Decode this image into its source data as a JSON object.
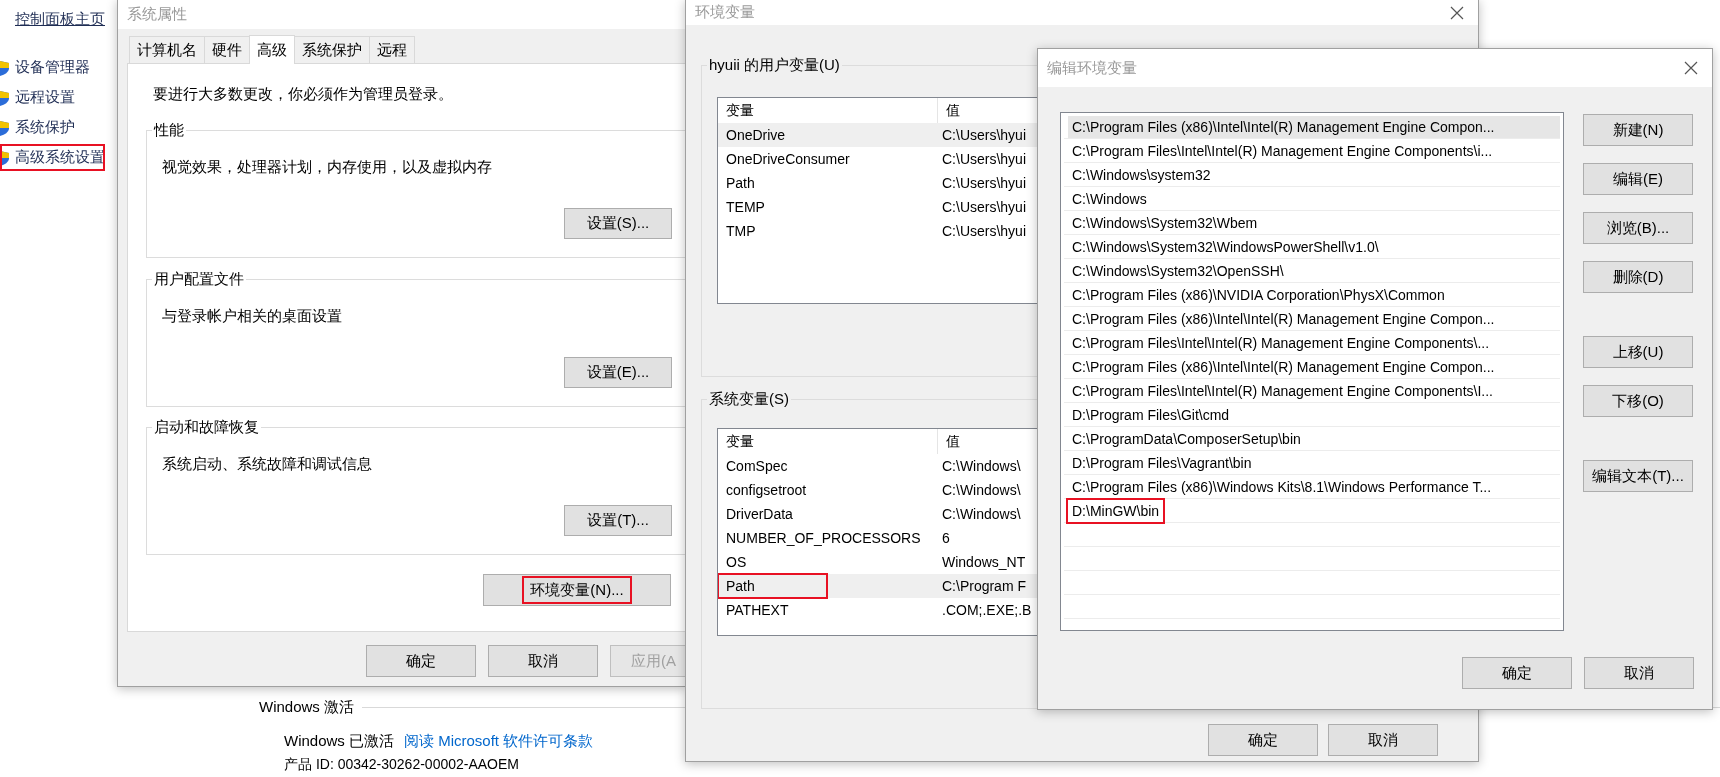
{
  "control_panel": {
    "home_link": "控制面板主页",
    "sidebar": {
      "items": [
        {
          "label": "设备管理器",
          "highlighted": false
        },
        {
          "label": "远程设置",
          "highlighted": false
        },
        {
          "label": "系统保护",
          "highlighted": false
        },
        {
          "label": "高级系统设置",
          "highlighted": true
        }
      ]
    },
    "activation": {
      "heading": "Windows 激活",
      "status": "Windows 已激活",
      "license_link": "阅读 Microsoft 软件许可条款",
      "product_id": "产品 ID: 00342-30262-00002-AAOEM"
    }
  },
  "system_properties": {
    "title": "系统属性",
    "tabs": [
      {
        "label": "计算机名",
        "selected": false
      },
      {
        "label": "硬件",
        "selected": false
      },
      {
        "label": "高级",
        "selected": true
      },
      {
        "label": "系统保护",
        "selected": false
      },
      {
        "label": "远程",
        "selected": false
      }
    ],
    "notice": "要进行大多数更改，你必须作为管理员登录。",
    "groups": [
      {
        "title": "性能",
        "description": "视觉效果，处理器计划，内存使用，以及虚拟内存",
        "button": "设置(S)..."
      },
      {
        "title": "用户配置文件",
        "description": "与登录帐户相关的桌面设置",
        "button": "设置(E)..."
      },
      {
        "title": "启动和故障恢复",
        "description": "系统启动、系统故障和调试信息",
        "button": "设置(T)..."
      }
    ],
    "env_button": {
      "label": "环境变量(N)...",
      "highlighted": true
    },
    "buttons": [
      {
        "label": "确定",
        "disabled": false
      },
      {
        "label": "取消",
        "disabled": false
      },
      {
        "label": "应用(A",
        "disabled": true
      }
    ]
  },
  "environment_variables": {
    "title": "环境变量",
    "user_vars": {
      "title": "hyuii 的用户变量(U)",
      "columns": [
        "变量",
        "值"
      ],
      "rows": [
        {
          "name": "OneDrive",
          "value": "C:\\Users\\hyui",
          "selected": true,
          "highlighted": false
        },
        {
          "name": "OneDriveConsumer",
          "value": "C:\\Users\\hyui",
          "selected": false,
          "highlighted": false
        },
        {
          "name": "Path",
          "value": "C:\\Users\\hyui",
          "selected": false,
          "highlighted": false
        },
        {
          "name": "TEMP",
          "value": "C:\\Users\\hyui",
          "selected": false,
          "highlighted": false
        },
        {
          "name": "TMP",
          "value": "C:\\Users\\hyui",
          "selected": false,
          "highlighted": false
        }
      ]
    },
    "system_vars": {
      "title": "系统变量(S)",
      "columns": [
        "变量",
        "值"
      ],
      "rows": [
        {
          "name": "ComSpec",
          "value": "C:\\Windows\\",
          "selected": false,
          "highlighted": false
        },
        {
          "name": "configsetroot",
          "value": "C:\\Windows\\",
          "selected": false,
          "highlighted": false
        },
        {
          "name": "DriverData",
          "value": "C:\\Windows\\",
          "selected": false,
          "highlighted": false
        },
        {
          "name": "NUMBER_OF_PROCESSORS",
          "value": "6",
          "selected": false,
          "highlighted": false
        },
        {
          "name": "OS",
          "value": "Windows_NT",
          "selected": false,
          "highlighted": false
        },
        {
          "name": "Path",
          "value": "C:\\Program F",
          "selected": true,
          "highlighted": true
        },
        {
          "name": "PATHEXT",
          "value": ".COM;.EXE;.B",
          "selected": false,
          "highlighted": false
        }
      ]
    },
    "buttons": [
      "确定",
      "取消"
    ]
  },
  "edit_variable": {
    "title": "编辑环境变量",
    "entries": [
      {
        "text": "C:\\Program Files (x86)\\Intel\\Intel(R) Management Engine Compon...",
        "selected": true,
        "highlighted": false
      },
      {
        "text": "C:\\Program Files\\Intel\\Intel(R) Management Engine Components\\i...",
        "selected": false,
        "highlighted": false
      },
      {
        "text": "C:\\Windows\\system32",
        "selected": false,
        "highlighted": false
      },
      {
        "text": "C:\\Windows",
        "selected": false,
        "highlighted": false
      },
      {
        "text": "C:\\Windows\\System32\\Wbem",
        "selected": false,
        "highlighted": false
      },
      {
        "text": "C:\\Windows\\System32\\WindowsPowerShell\\v1.0\\",
        "selected": false,
        "highlighted": false
      },
      {
        "text": "C:\\Windows\\System32\\OpenSSH\\",
        "selected": false,
        "highlighted": false
      },
      {
        "text": "C:\\Program Files (x86)\\NVIDIA Corporation\\PhysX\\Common",
        "selected": false,
        "highlighted": false
      },
      {
        "text": "C:\\Program Files (x86)\\Intel\\Intel(R) Management Engine Compon...",
        "selected": false,
        "highlighted": false
      },
      {
        "text": "C:\\Program Files\\Intel\\Intel(R) Management Engine Components\\...",
        "selected": false,
        "highlighted": false
      },
      {
        "text": "C:\\Program Files (x86)\\Intel\\Intel(R) Management Engine Compon...",
        "selected": false,
        "highlighted": false
      },
      {
        "text": "C:\\Program Files\\Intel\\Intel(R) Management Engine Components\\I...",
        "selected": false,
        "highlighted": false
      },
      {
        "text": "D:\\Program Files\\Git\\cmd",
        "selected": false,
        "highlighted": false
      },
      {
        "text": "C:\\ProgramData\\ComposerSetup\\bin",
        "selected": false,
        "highlighted": false
      },
      {
        "text": "D:\\Program Files\\Vagrant\\bin",
        "selected": false,
        "highlighted": false
      },
      {
        "text": "C:\\Program Files (x86)\\Windows Kits\\8.1\\Windows Performance T...",
        "selected": false,
        "highlighted": false
      },
      {
        "text": "D:\\MinGW\\bin",
        "selected": false,
        "highlighted": true
      }
    ],
    "side_buttons": [
      [
        "新建(N)",
        "编辑(E)",
        "浏览(B)...",
        "删除(D)"
      ],
      [
        "上移(U)",
        "下移(O)"
      ],
      [
        "编辑文本(T)..."
      ]
    ],
    "buttons": [
      "确定",
      "取消"
    ]
  }
}
